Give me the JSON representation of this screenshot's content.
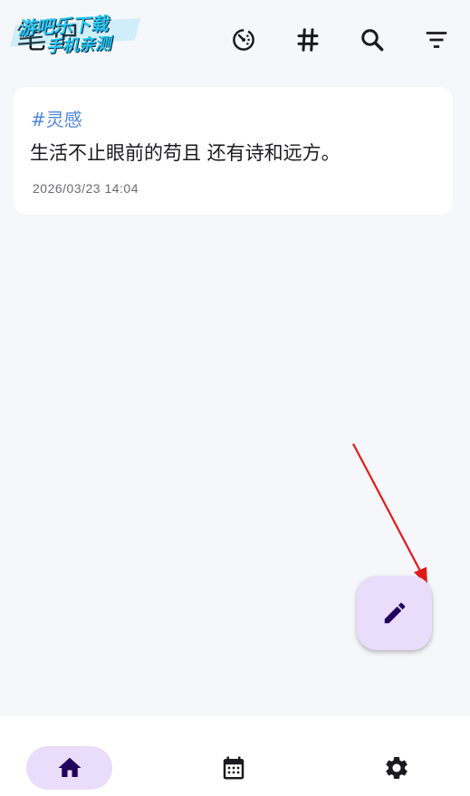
{
  "app_bar": {
    "title": "笔记",
    "watermark_line1": "游吧乐下载",
    "watermark_line2": "手机亲测",
    "actions": [
      {
        "icon": "timer-icon"
      },
      {
        "icon": "hashtag-icon"
      },
      {
        "icon": "search-icon"
      },
      {
        "icon": "filter-icon"
      }
    ]
  },
  "notes": [
    {
      "tag": "#灵感",
      "text": "生活不止眼前的苟且 还有诗和远方。",
      "date": "2026/03/23 14:04"
    }
  ],
  "fab": {
    "icon": "edit-pencil-icon"
  },
  "bottom_nav": {
    "items": [
      {
        "icon": "home-icon",
        "selected": true
      },
      {
        "icon": "calendar-icon",
        "selected": false
      },
      {
        "icon": "settings-gear-icon",
        "selected": false
      }
    ]
  },
  "colors": {
    "background": "#f6f7fa",
    "card": "#ffffff",
    "tag": "#4f86d8",
    "accent_container": "#eadcfb",
    "on_accent": "#21005d",
    "icon": "#1b1b1f",
    "annotation_arrow": "#e01b1b"
  }
}
